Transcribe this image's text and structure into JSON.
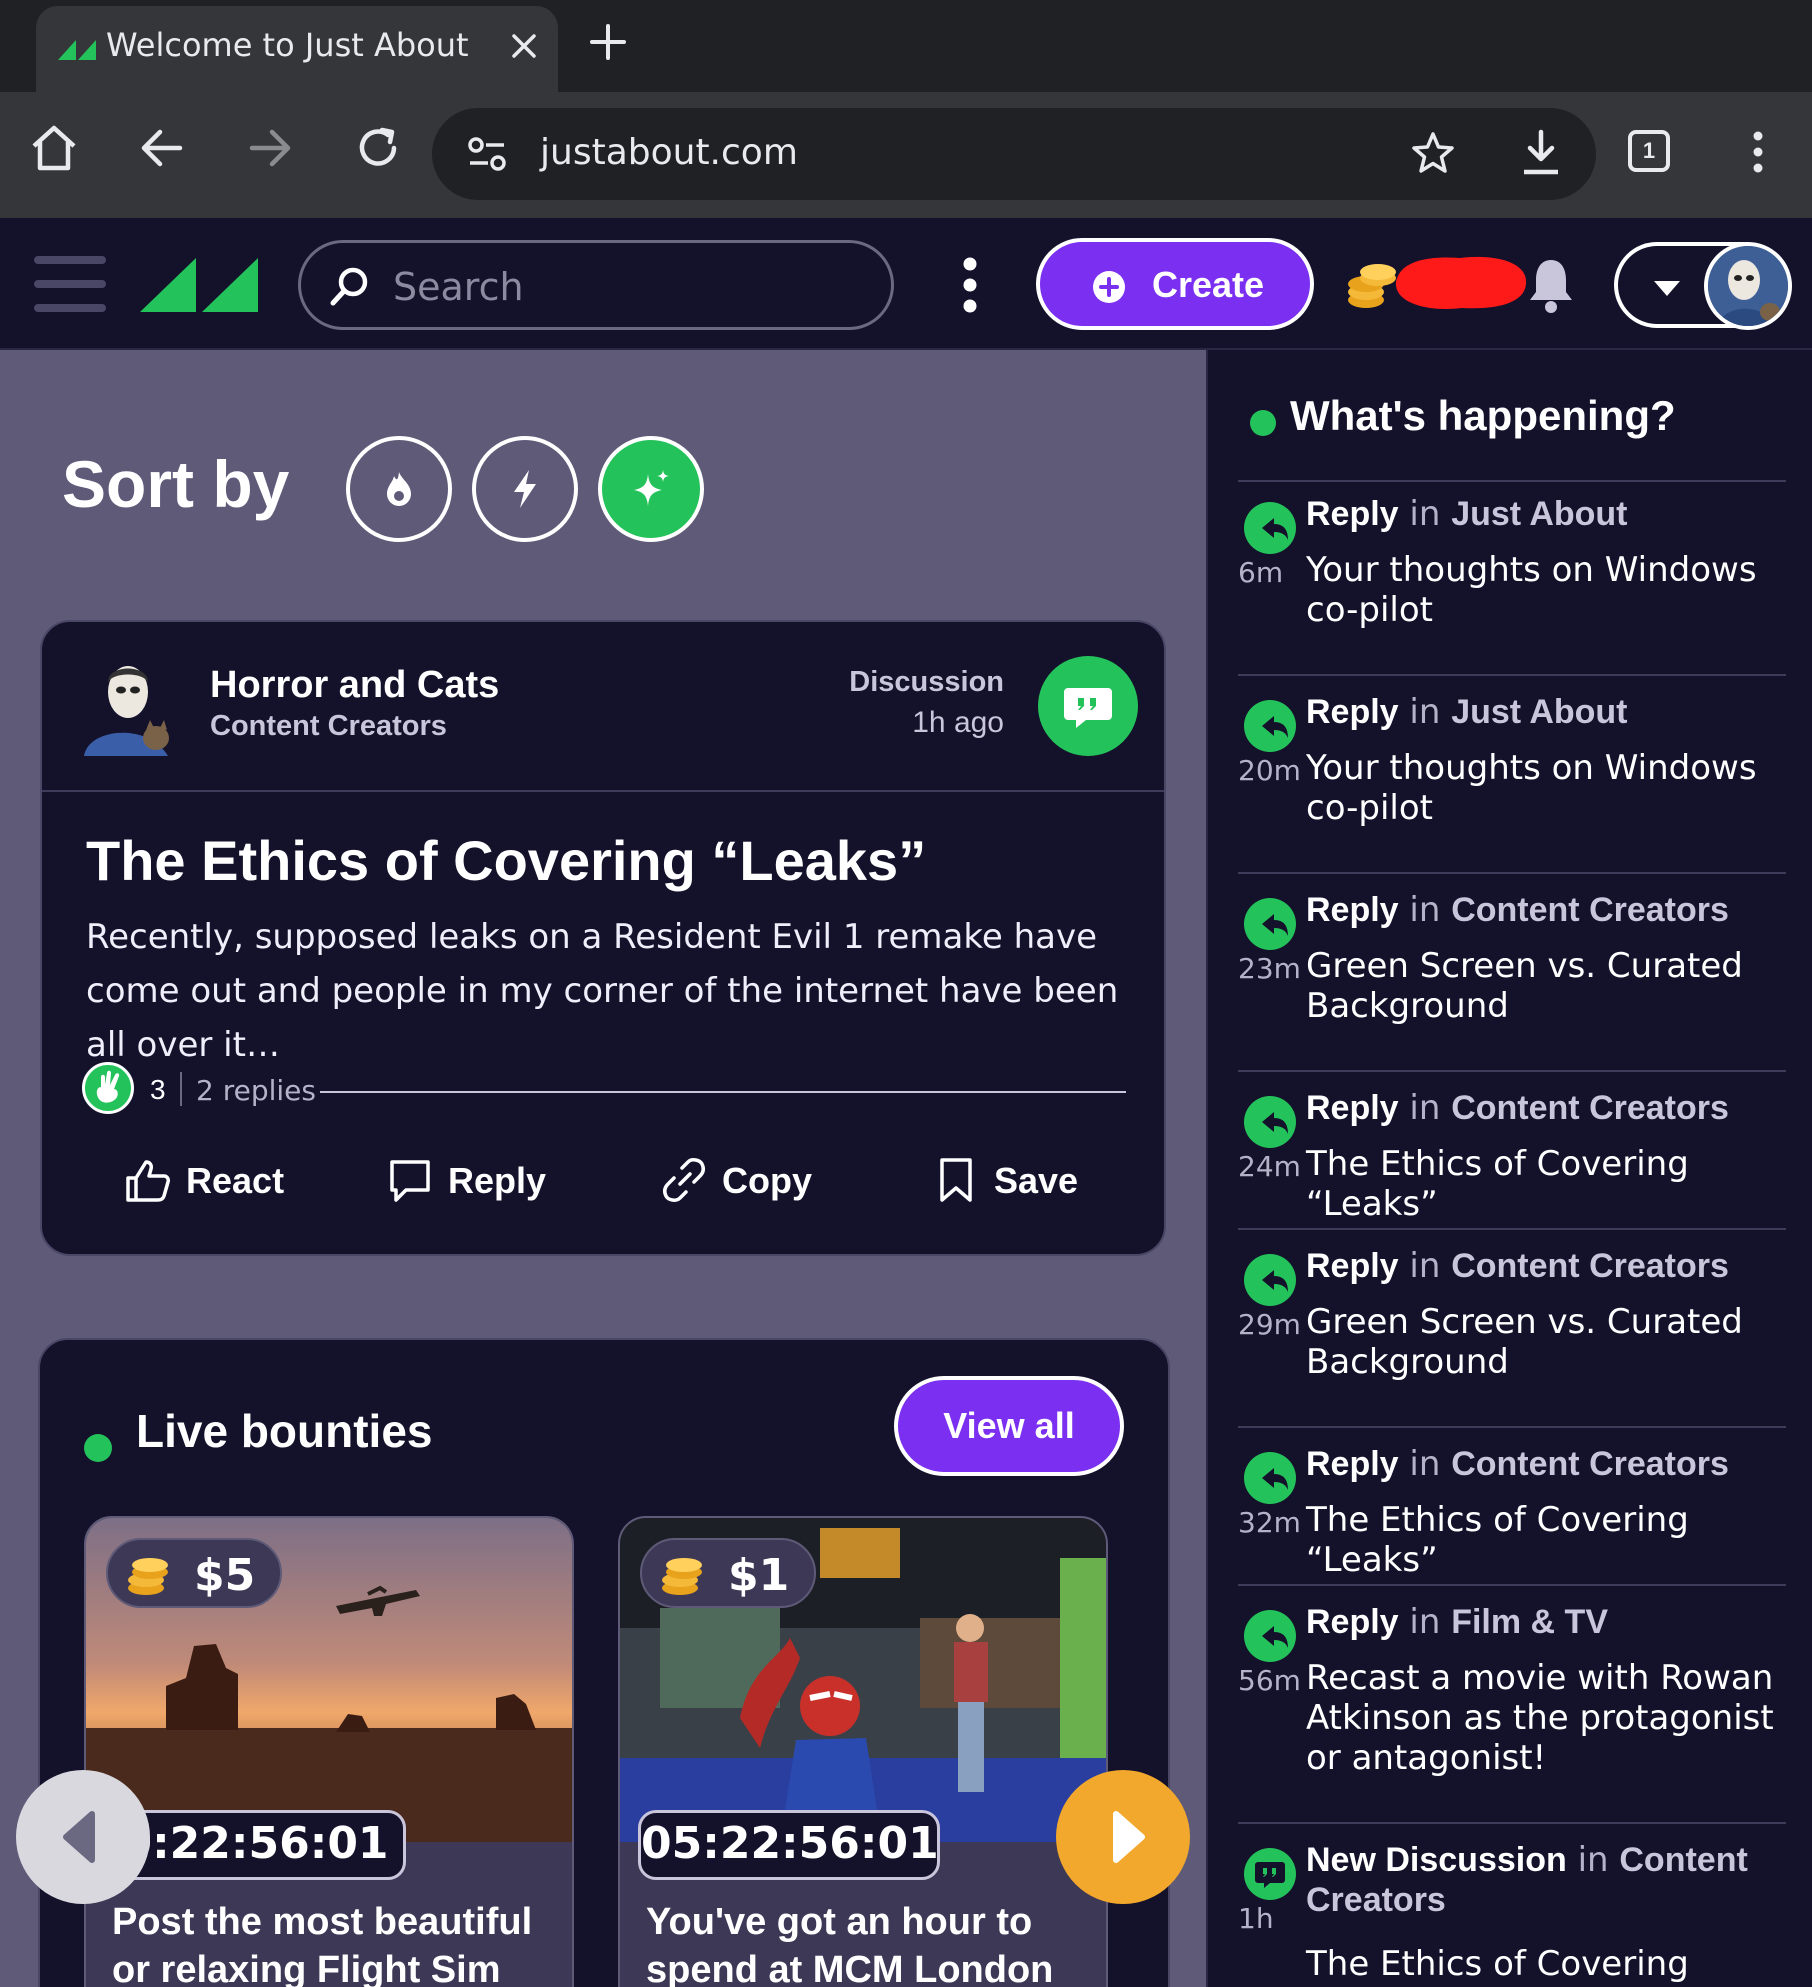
{
  "browser": {
    "tab_title": "Welcome to Just About",
    "url": "justabout.com",
    "tab_count": "1"
  },
  "header": {
    "search_placeholder": "Search",
    "create_label": "Create"
  },
  "sort": {
    "label": "Sort by",
    "options": [
      "hot-icon",
      "new-icon",
      "ai-sparkle-icon"
    ],
    "active": "ai-sparkle-icon"
  },
  "post": {
    "author": "Horror and Cats",
    "community": "Content Creators",
    "type": "Discussion",
    "time": "1h ago",
    "title": "The Ethics of Covering “Leaks”",
    "excerpt": "Recently, supposed leaks on a Resident Evil 1 remake have come out and people in my corner of the internet have been all over it…",
    "reaction_count": "3",
    "replies": "2 replies",
    "actions": {
      "react": "React",
      "reply": "Reply",
      "copy": "Copy",
      "save": "Save"
    }
  },
  "bounties": {
    "heading": "Live bounties",
    "view_all": "View all",
    "items": [
      {
        "price": "$5",
        "timer": "0:22:56:01",
        "title": "Post the most beautiful or relaxing Flight Sim"
      },
      {
        "price": "$1",
        "timer": "05:22:56:01",
        "title": "You've got an hour to spend at MCM London"
      }
    ]
  },
  "sidebar": {
    "title": "What's happening?",
    "items": [
      {
        "kind": "Reply",
        "in": "in",
        "community": "Just About",
        "age": "6m",
        "text": "Your thoughts on Windows co-pilot",
        "icon": "reply-icon"
      },
      {
        "kind": "Reply",
        "in": "in",
        "community": "Just About",
        "age": "20m",
        "text": "Your thoughts on Windows co-pilot",
        "icon": "reply-icon"
      },
      {
        "kind": "Reply",
        "in": "in",
        "community": "Content Creators",
        "age": "23m",
        "text": "Green Screen vs. Curated Background",
        "icon": "reply-icon"
      },
      {
        "kind": "Reply",
        "in": "in",
        "community": "Content Creators",
        "age": "24m",
        "text": "The Ethics of Covering “Leaks”",
        "icon": "reply-icon"
      },
      {
        "kind": "Reply",
        "in": "in",
        "community": "Content Creators",
        "age": "29m",
        "text": "Green Screen vs. Curated Background",
        "icon": "reply-icon"
      },
      {
        "kind": "Reply",
        "in": "in",
        "community": "Content Creators",
        "age": "32m",
        "text": "The Ethics of Covering “Leaks”",
        "icon": "reply-icon"
      },
      {
        "kind": "Reply",
        "in": "in",
        "community": "Film & TV",
        "age": "56m",
        "text": "Recast a movie with Rowan Atkinson as the protagonist or antagonist!",
        "icon": "reply-icon"
      },
      {
        "kind": "New Discussion",
        "in": "in",
        "community": "Content Creators",
        "age": "1h",
        "text": "The Ethics of Covering “Leaks”",
        "icon": "discussion-icon"
      }
    ]
  },
  "colors": {
    "brand_green": "#24c25a",
    "brand_purple": "#7b2ff0",
    "header_bg": "#14112b",
    "feed_bg": "#5e5a78",
    "next_button": "#f2a82c"
  }
}
